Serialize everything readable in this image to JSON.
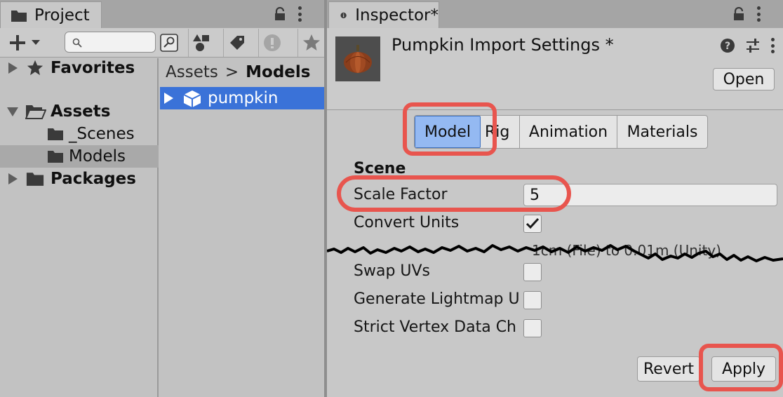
{
  "project": {
    "tab_title": "Project",
    "search": {
      "value": "",
      "placeholder": ""
    },
    "sidebar": {
      "favorites": "Favorites",
      "assets": "Assets",
      "scenes": "_Scenes",
      "models": "Models",
      "packages": "Packages"
    },
    "breadcrumb": {
      "root": "Assets",
      "separator": ">",
      "current": "Models"
    },
    "files": [
      {
        "name": "pumpkin"
      }
    ]
  },
  "inspector": {
    "tab_title": "Inspector*",
    "title": "Pumpkin Import Settings *",
    "open_label": "Open",
    "tabs": [
      {
        "label": "Model"
      },
      {
        "label": "Rig"
      },
      {
        "label": "Animation"
      },
      {
        "label": "Materials"
      }
    ],
    "section": "Scene",
    "fields": {
      "scale_factor": {
        "label": "Scale Factor",
        "value": "5"
      },
      "convert_units": {
        "label": "Convert Units",
        "checked": true,
        "note": "1cm (File) to 0.01m (Unity)"
      },
      "swap_uvs": {
        "label": "Swap UVs",
        "checked": false
      },
      "generate_lightmap": {
        "label": "Generate Lightmap U",
        "checked": false
      },
      "strict_vertex": {
        "label": "Strict Vertex Data Ch",
        "checked": false
      }
    },
    "revert_label": "Revert",
    "apply_label": "Apply"
  },
  "colors": {
    "highlight": "#e8554e",
    "selection": "#3a72d8",
    "active_tab": "#94b9f2"
  }
}
